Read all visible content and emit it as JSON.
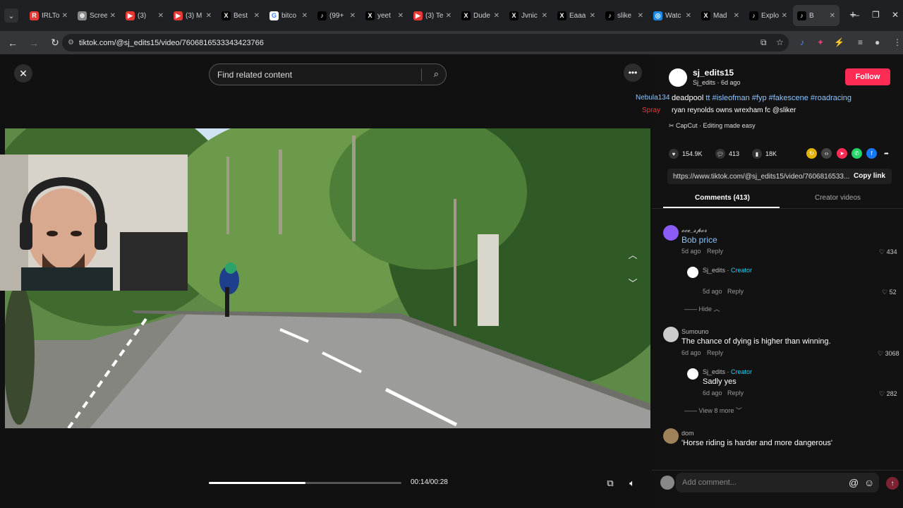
{
  "browser": {
    "tabs": [
      {
        "label": "IRLTo",
        "icon": "R",
        "icon_color": "#e53935"
      },
      {
        "label": "Scree",
        "icon": "⊕",
        "icon_color": "#888888"
      },
      {
        "label": "(3)",
        "icon": "▶",
        "icon_color": "#e53935"
      },
      {
        "label": "(3) M",
        "icon": "▶",
        "icon_color": "#e53935"
      },
      {
        "label": "Best",
        "icon": "X",
        "icon_color": "#000000"
      },
      {
        "label": "bitco",
        "icon": "G",
        "icon_color": "#ffffff"
      },
      {
        "label": "(99+",
        "icon": "♪",
        "icon_color": "#000000"
      },
      {
        "label": "yeet",
        "icon": "X",
        "icon_color": "#000000"
      },
      {
        "label": "(3) Te",
        "icon": "▶",
        "icon_color": "#e53935"
      },
      {
        "label": "Dude",
        "icon": "X",
        "icon_color": "#000000"
      },
      {
        "label": "Jvnic",
        "icon": "X",
        "icon_color": "#000000"
      },
      {
        "label": "Eaaa",
        "icon": "X",
        "icon_color": "#000000"
      },
      {
        "label": "slike",
        "icon": "♪",
        "icon_color": "#000000"
      },
      {
        "label": "Watc",
        "icon": "◎",
        "icon_color": "#1e88e5"
      },
      {
        "label": "Mad",
        "icon": "X",
        "icon_color": "#000000"
      },
      {
        "label": "Explo",
        "icon": "♪",
        "icon_color": "#000000"
      },
      {
        "label": "B",
        "icon": "♪",
        "icon_color": "#000000"
      }
    ],
    "url": "tiktok.com/@sj_edits15/video/7606816533343423766"
  },
  "player": {
    "search_placeholder": "Find related content",
    "time": "00:14/00:28",
    "progress": 0.5
  },
  "author": {
    "username": "sj_edits15",
    "subline": "Sj_edits · 6d ago",
    "follow_label": "Follow"
  },
  "overlay": {
    "left_names": [
      "Nebula134",
      "Spray"
    ],
    "caption_line1_prefix": "deadpool",
    "caption_line1_tags": "tt #isleofman #fyp #fakescene #roadracing",
    "caption_line2": "ryan reynolds owns wrexham fc @sliker",
    "capcut": "CapCut · Editing made easy"
  },
  "stats": {
    "likes": "154.9K",
    "comments": "413",
    "saves": "18K"
  },
  "link": {
    "url": "https://www.tiktok.com/@sj_edits15/video/7606816533...",
    "copy_label": "Copy link"
  },
  "tabs": {
    "comments": "Comments (413)",
    "creator_videos": "Creator videos"
  },
  "comments": [
    {
      "name": "𝓸𝓬𝓮_𝓼𝓹𝓸𝓻",
      "text": "Bob price",
      "age": "5d ago",
      "reply": "Reply",
      "likes": "434"
    },
    {
      "name": "Sj_edits",
      "badge": "Creator",
      "text": "",
      "age": "5d ago",
      "reply": "Reply",
      "likes": "52"
    },
    {
      "name": "Sumouno",
      "text": "The chance of dying is higher than winning.",
      "age": "6d ago",
      "reply": "Reply",
      "likes": "3068"
    },
    {
      "name": "Sj_edits",
      "badge": "Creator",
      "text": "Sadly yes",
      "age": "6d ago",
      "reply": "Reply",
      "likes": "282"
    },
    {
      "name": "dom",
      "text": "'Horse riding is harder and more dangerous' ",
      "age": "",
      "reply": "",
      "likes": ""
    }
  ],
  "hide_label": "Hide",
  "view_more_label": "View 8 more",
  "add_comment_placeholder": "Add comment..."
}
